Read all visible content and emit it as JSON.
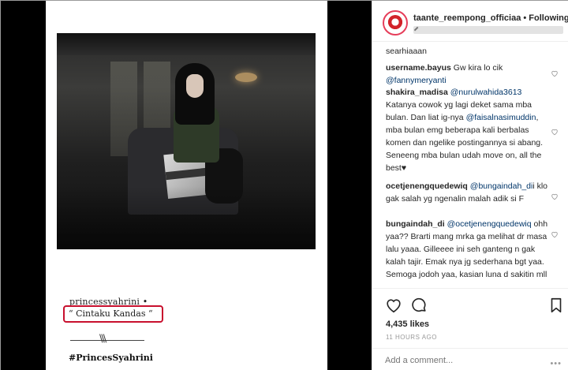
{
  "post": {
    "caption_user": "princessyahrini  •",
    "caption_text": "“ Cintaku Kandas “",
    "signature_mark": "\\\\\\",
    "hashtag": "#PrincesSyahrini"
  },
  "header": {
    "handle": "taante_reempong_officiaa",
    "separator": " • ",
    "follow": "Following"
  },
  "comments": [
    {
      "text": "searhiaaan"
    },
    {
      "user": "username.bayus",
      "text": " Gw kira lo cik ",
      "mention": "@fannymeryanti"
    },
    {
      "user": "shakira_madisa",
      "mention": "@nurulwahida3613",
      "text": "Katanya cowok yg lagi deket sama mba bulan. Dan liat ig-nya ",
      "mention2": "@faisalnasimuddin",
      "text2": ", mba bulan emg beberapa kali berbalas komen dan ngelike postingannya si abang. Seneeng mba bulan udah move on, all the best♥"
    },
    {
      "user": "ocetjenengquedewiq",
      "mention": "@bungaindah_di",
      "text": "i klo gak salah yg ngenalin malah adik si F"
    },
    {
      "user": "bungaindah_di",
      "mention": "@ocetjenengquedewiq",
      "text": "ohh yaa?? Brarti mang mrka ga melihat dr masa lalu yaaa. Gilleeee ini seh ganteng n gak kalah tajir. Emak nya jg sederhana bgt yaa. Semoga jodoh yaa, kasian luna d sakitin mll"
    }
  ],
  "actions": {
    "likes": "4,435 likes",
    "time_ago": "11 HOURS AGO",
    "add_comment_placeholder": "Add a comment...",
    "more": "•••"
  },
  "colors": {
    "highlight_box": "#c8102e",
    "mention": "#003569",
    "avatar_ring": "#e63e5a"
  }
}
